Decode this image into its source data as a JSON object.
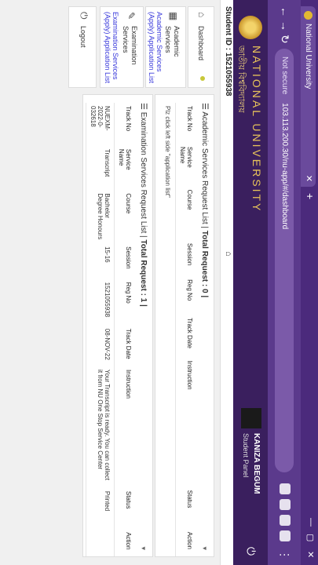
{
  "browser": {
    "tab_title": "National University",
    "security": "Not secure",
    "url": "103.113.200.30/nu-app/#/dashboard",
    "icons": {
      "back": "arrow-left-icon",
      "forward": "arrow-right-icon",
      "reload": "reload-icon"
    }
  },
  "header": {
    "name_en": "NATIONAL UNIVERSITY",
    "name_bn": "জাতীয় বিশ্ববিদ্যালয়",
    "user_name": "KANIZA BEGUM",
    "user_role": "Student Panel"
  },
  "subbar": {
    "student_id": "Student ID : 1521055938"
  },
  "sidebar": {
    "items": [
      {
        "label": "Dashboard",
        "icon": "home-icon"
      },
      {
        "label": "Academic Services",
        "icon": "building-icon",
        "link": "Academic Services (Apply) Application List"
      },
      {
        "label": "Examination Services",
        "icon": "edit-icon",
        "link": "Examination Services (Apply) Application List"
      },
      {
        "label": "Logout",
        "icon": "power-icon"
      }
    ]
  },
  "academic": {
    "title": "Academic Services Request List | ",
    "total": "Total Request : 0 |",
    "columns": [
      "Track No",
      "Service Name",
      "Course",
      "Session",
      "Reg No",
      "Track Date",
      "Instruction",
      "Status",
      "Action"
    ],
    "note": "Plz click left side \"application list\""
  },
  "exam": {
    "title": "Examination Services Request List | ",
    "total": "Total Request : 1 |",
    "columns": [
      "Track No",
      "Service Name",
      "Course",
      "Session",
      "Reg No",
      "Track Date",
      "Instruction",
      "Status",
      "Action"
    ],
    "rows": [
      {
        "track": "NUEXM-2022-0-032618",
        "service": "Transcript",
        "course": "Bachelor Degree Honours",
        "session": "15-16",
        "reg": "1521055938",
        "date": "08-NOV-22",
        "instruction": "Your Transcript is ready. You can collect it from NU One Stop Service Center",
        "status": "Printed",
        "action": ""
      }
    ]
  }
}
